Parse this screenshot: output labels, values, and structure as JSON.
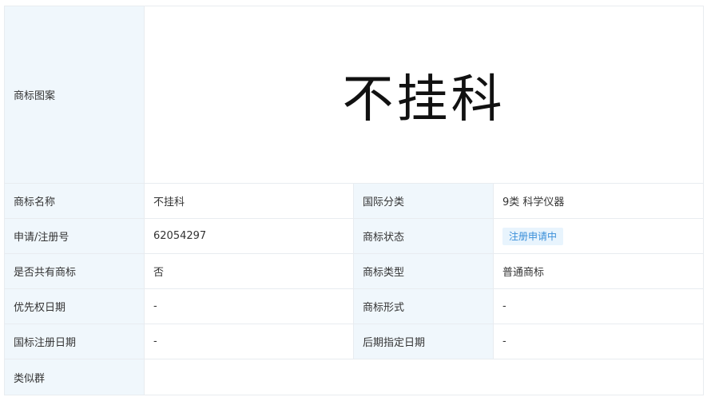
{
  "trademark": {
    "image_label": "商标图案",
    "image_text": "不挂科",
    "name_label": "商标名称",
    "name_value": "不挂科",
    "intl_class_label": "国际分类",
    "intl_class_value": "9类 科学仪器",
    "reg_no_label": "申请/注册号",
    "reg_no_value": "62054297",
    "status_label": "商标状态",
    "status_value": "注册申请中",
    "shared_label": "是否共有商标",
    "shared_value": "否",
    "type_label": "商标类型",
    "type_value": "普通商标",
    "priority_date_label": "优先权日期",
    "priority_date_value": "-",
    "form_label": "商标形式",
    "form_value": "-",
    "intl_reg_date_label": "国标注册日期",
    "intl_reg_date_value": "-",
    "later_date_label": "后期指定日期",
    "later_date_value": "-",
    "similar_group_label": "类似群",
    "similar_group_value": ""
  },
  "colors": {
    "label_bg": "#f0f7fc",
    "border": "#e8ecf0",
    "badge_bg": "#e8f4fd",
    "badge_text": "#3a8fd9"
  }
}
